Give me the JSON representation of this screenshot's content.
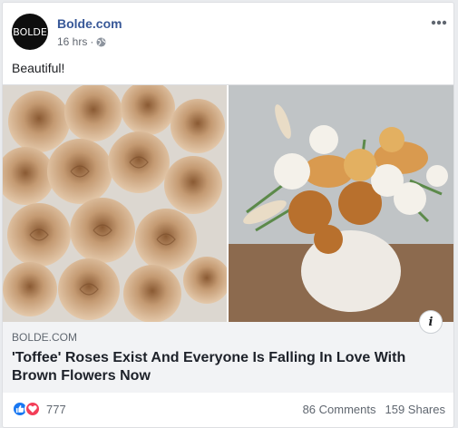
{
  "post": {
    "page_name": "Bolde.com",
    "avatar_text": "BOLDE",
    "time": "16 hrs",
    "separator": "·",
    "more_icon": "more-icon",
    "message": "Beautiful!",
    "link": {
      "domain": "BOLDE.COM",
      "headline": "'Toffee' Roses Exist And Everyone Is Falling In Love With Brown Flowers Now",
      "info_icon": "i"
    },
    "footer": {
      "reaction_count": "777",
      "comments": "86 Comments",
      "shares": "159 Shares"
    }
  },
  "colors": {
    "link_blue": "#385898",
    "like_blue": "#1877f2",
    "love_red": "#f33e58"
  }
}
